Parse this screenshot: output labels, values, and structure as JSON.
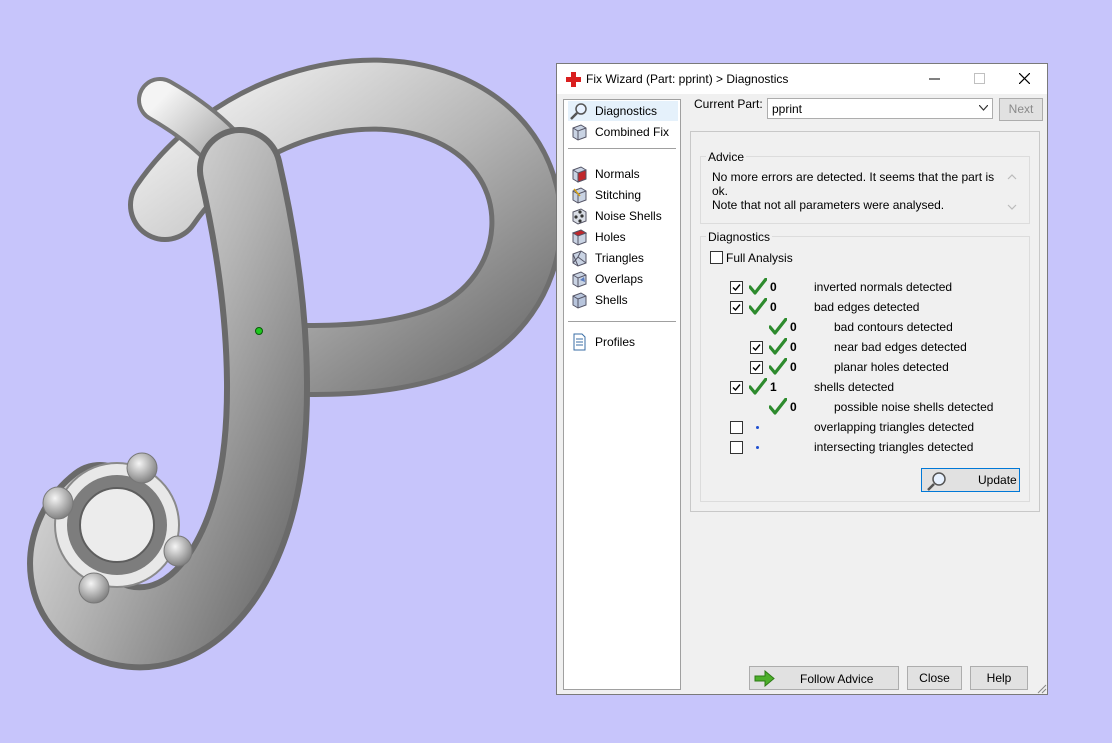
{
  "dialog": {
    "title": "Fix Wizard (Part: pprint) > Diagnostics",
    "colors": {
      "accent": "#0078d7",
      "check_green": "#2e8b2e",
      "icon_red": "#d91f1f"
    }
  },
  "sidebar": {
    "items": [
      {
        "label": "Diagnostics",
        "icon": "magnifier-icon"
      },
      {
        "label": "Combined Fix",
        "icon": "cube-icon"
      },
      {
        "label": "Normals",
        "icon": "cube-red-face-icon"
      },
      {
        "label": "Stitching",
        "icon": "cube-stitch-icon"
      },
      {
        "label": "Noise Shells",
        "icon": "cube-dots-icon"
      },
      {
        "label": "Holes",
        "icon": "cube-hole-icon"
      },
      {
        "label": "Triangles",
        "icon": "cube-triangles-icon"
      },
      {
        "label": "Overlaps",
        "icon": "cube-overlap-icon"
      },
      {
        "label": "Shells",
        "icon": "cube-shells-icon"
      },
      {
        "label": "Profiles",
        "icon": "document-icon"
      }
    ]
  },
  "part": {
    "label": "Current Part:",
    "value": "pprint"
  },
  "next_label": "Next",
  "advice": {
    "title": "Advice",
    "line1": "No more errors are detected. It seems that the part is ok.",
    "line2": "Note that not all parameters were analysed."
  },
  "diagnostics": {
    "title": "Diagnostics",
    "full_analysis": "Full Analysis",
    "rows": [
      {
        "count": "0",
        "label": "inverted normals detected",
        "checked": true
      },
      {
        "count": "0",
        "label": "bad edges detected",
        "checked": true
      },
      {
        "count": "0",
        "label": "bad contours detected",
        "checked": null
      },
      {
        "count": "0",
        "label": "near bad edges detected",
        "checked": true
      },
      {
        "count": "0",
        "label": "planar holes detected",
        "checked": true
      },
      {
        "count": "1",
        "label": "shells detected",
        "checked": true
      },
      {
        "count": "0",
        "label": "possible noise shells detected",
        "checked": null
      },
      {
        "count": "",
        "label": "overlapping triangles detected",
        "checked": false
      },
      {
        "count": "",
        "label": "intersecting triangles detected",
        "checked": false
      }
    ]
  },
  "buttons": {
    "update": "Update",
    "follow_advice": "Follow Advice",
    "close": "Close",
    "help": "Help"
  }
}
